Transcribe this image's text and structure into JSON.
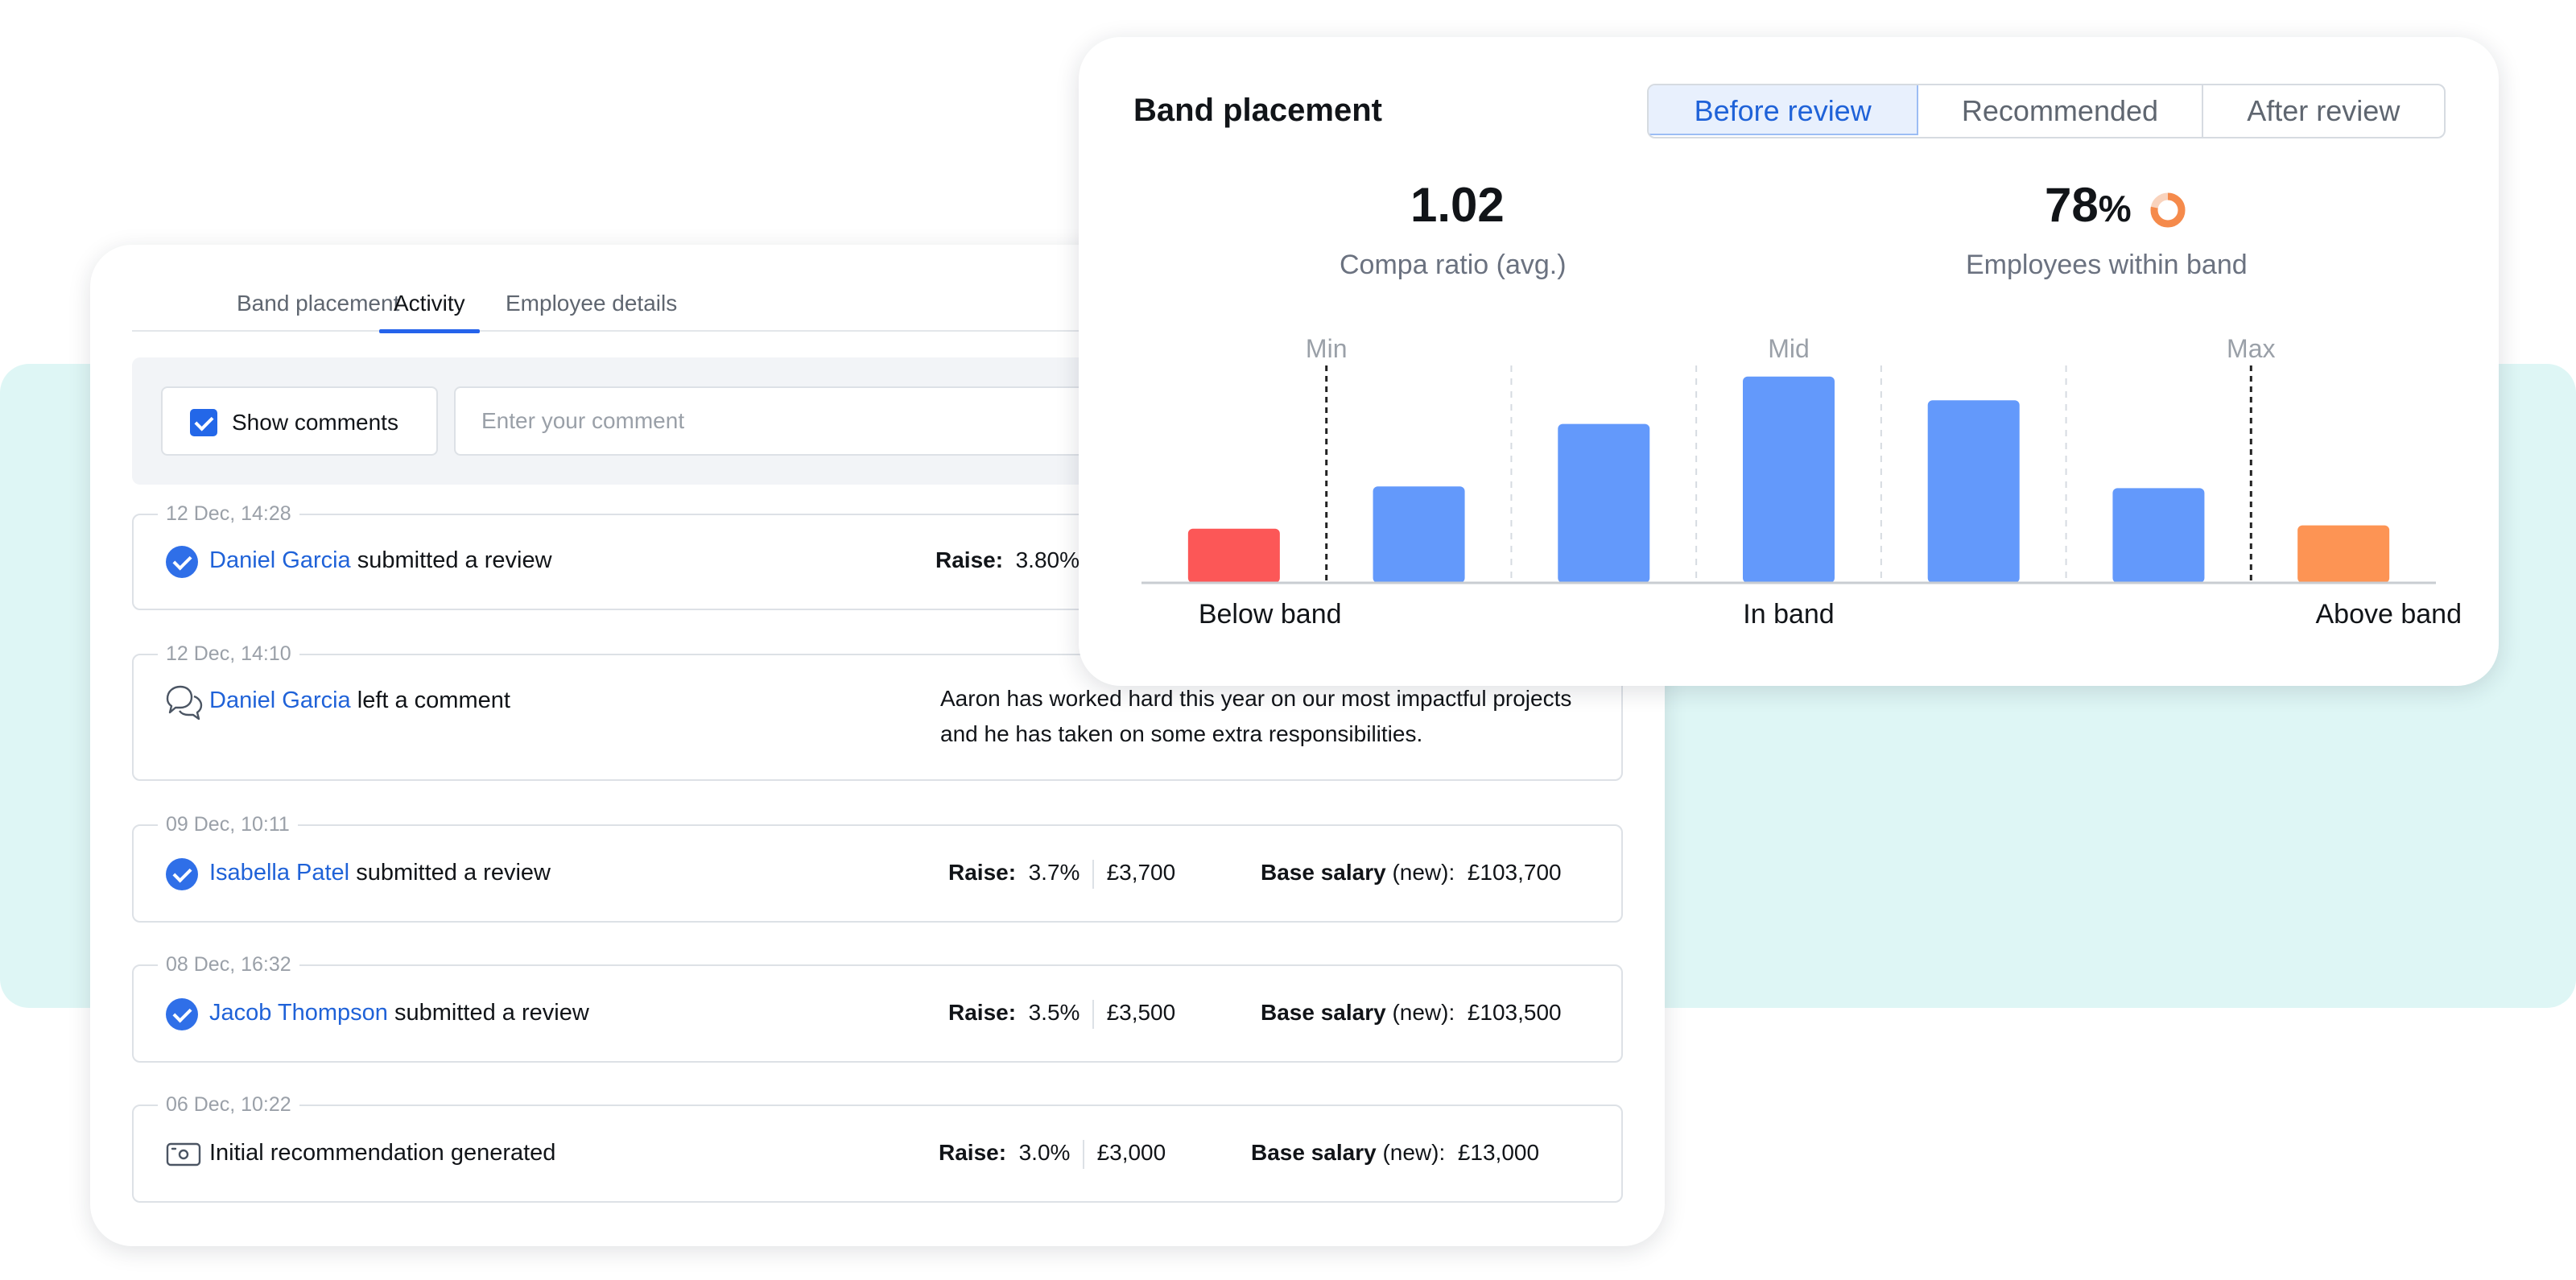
{
  "activity_card": {
    "tabs": [
      "Band placement",
      "Activity",
      "Employee details"
    ],
    "active_tab": "Activity",
    "show_comments": {
      "label": "Show comments",
      "checked": true
    },
    "comment_input": {
      "placeholder": "Enter your comment",
      "value": ""
    },
    "entries": [
      {
        "time": "12 Dec, 14:28",
        "icon": "check-circle-icon",
        "person": "Daniel Garcia",
        "action": "submitted a review",
        "raise_label": "Raise:",
        "raise_pct": "3.80%"
      },
      {
        "time": "12 Dec, 14:10",
        "icon": "comment-icon",
        "person": "Daniel Garcia",
        "action": "left a comment",
        "comment": "Aaron has worked hard this year on our most impactful projects and he has taken on some extra responsibilities."
      },
      {
        "time": "09 Dec, 10:11",
        "icon": "check-circle-icon",
        "person": "Isabella Patel",
        "action": "submitted a review",
        "raise_label": "Raise:",
        "raise_pct": "3.7%",
        "raise_amount": "£3,700",
        "salary_label": "Base salary",
        "salary_qualifier": "(new):",
        "salary": "£103,700"
      },
      {
        "time": "08 Dec, 16:32",
        "icon": "check-circle-icon",
        "person": "Jacob Thompson",
        "action": "submitted a review",
        "raise_label": "Raise:",
        "raise_pct": "3.5%",
        "raise_amount": "£3,500",
        "salary_label": "Base salary",
        "salary_qualifier": "(new):",
        "salary": "£103,500"
      },
      {
        "time": "06 Dec, 10:22",
        "icon": "money-icon",
        "action": "Initial recommendation generated",
        "raise_label": "Raise:",
        "raise_pct": "3.0%",
        "raise_amount": "£3,000",
        "salary_label": "Base salary",
        "salary_qualifier": "(new):",
        "salary": "£13,000"
      }
    ]
  },
  "band_card": {
    "title": "Band placement",
    "segments": [
      "Before review",
      "Recommended",
      "After review"
    ],
    "active_segment": "Before review",
    "compa_ratio": {
      "value": "1.02",
      "label": "Compa ratio (avg.)"
    },
    "within_band": {
      "value": "78",
      "unit": "%",
      "label": "Employees within band",
      "fraction": 0.78
    }
  },
  "chart_data": {
    "type": "bar",
    "markers": [
      "Min",
      "Mid",
      "Max"
    ],
    "zone_labels": [
      "Below band",
      "In band",
      "Above band"
    ],
    "values": [
      32,
      57,
      94,
      122,
      108,
      56,
      34
    ],
    "zones": [
      "below",
      "in",
      "in",
      "in",
      "in",
      "in",
      "above"
    ],
    "colors": {
      "below": "#fc5757",
      "in": "#6399fb",
      "above": "#fd9454",
      "baseline": "#c9cdd2",
      "guide": "#d6dbe1",
      "limit": "#222222",
      "marker_text": "#9aa0a8"
    }
  },
  "colors": {
    "accent": "#2563eb",
    "link": "#1f62d8",
    "teal_band": "#def6f5",
    "donut_fill": "#f58a4b",
    "donut_track": "#f9d3bd"
  }
}
